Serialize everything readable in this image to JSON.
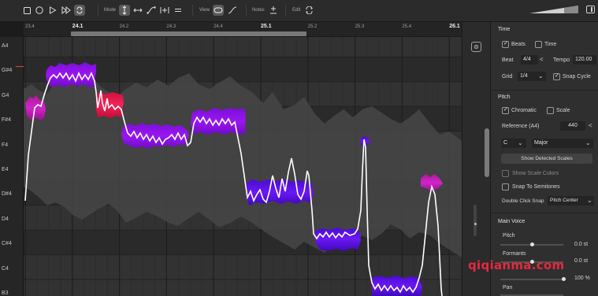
{
  "toolbar": {
    "mode_label": "Mode",
    "view_label": "View",
    "notes_label": "Notes",
    "edit_label": "Edit",
    "icons": [
      "stop-icon",
      "record-icon",
      "play-icon",
      "fast-forward-icon",
      "loop-icon",
      "pitch-tool-icon",
      "time-tool-icon",
      "curve-tool-icon",
      "split-tool-icon",
      "equal-tool-icon",
      "note-view-icon",
      "curve-view-icon",
      "add-note-icon",
      "edit-cycle-icon"
    ]
  },
  "timeline": {
    "markers": [
      "23.4",
      "24.1",
      "24.2",
      "24.3",
      "24.4",
      "25.1",
      "25.2",
      "25.3",
      "25.4",
      "26.1"
    ],
    "major": [
      "24.1",
      "25.1",
      "26.1"
    ]
  },
  "piano_keys": [
    "A4",
    "G#4",
    "G4",
    "F#4",
    "F4",
    "E4",
    "D#4",
    "D4",
    "C#4",
    "C4",
    "B3"
  ],
  "inspector": {
    "time": {
      "title": "Time",
      "beats_label": "Beats",
      "beats_checked": true,
      "time_label": "Time",
      "time_checked": false,
      "beat_label": "Beat",
      "beat_value": "4/4",
      "tempo_label": "Tempo",
      "tempo_value": "120.00",
      "grid_label": "Grid",
      "grid_value": "1/4",
      "snap_cycle_label": "Snap Cycle",
      "snap_cycle_checked": true
    },
    "pitch": {
      "title": "Pitch",
      "chromatic_label": "Chromatic",
      "chromatic_checked": true,
      "scale_label": "Scale",
      "scale_checked": false,
      "reference_label": "Reference (A4)",
      "reference_value": "440",
      "key_value": "C",
      "mode_value": "Major",
      "show_scales_button": "Show Detected Scales",
      "show_scale_colors_label": "Show Scale Colors",
      "snap_semitones_label": "Snap To Semitones",
      "double_click_label": "Double Click Snap",
      "double_click_value": "Pitch Center"
    },
    "main_voice": {
      "title": "Main Voice",
      "pitch_label": "Pitch",
      "pitch_value": "0.0 st",
      "pitch_level": 0.5,
      "formants_label": "Formants",
      "formants_value": "0.0 st",
      "formants_level": 0.5,
      "gain_value": "100 %",
      "gain_level": 1.0,
      "pan_label": "Pan",
      "pan_level": 0.5
    }
  },
  "watermark": "qiqianma.com",
  "colors": {
    "note_violet": "#8a10ee",
    "note_blue": "#5a10ee",
    "note_magenta": "#c21cbc",
    "note_red": "#e0184a",
    "pitch_curve": "#ffffff"
  }
}
